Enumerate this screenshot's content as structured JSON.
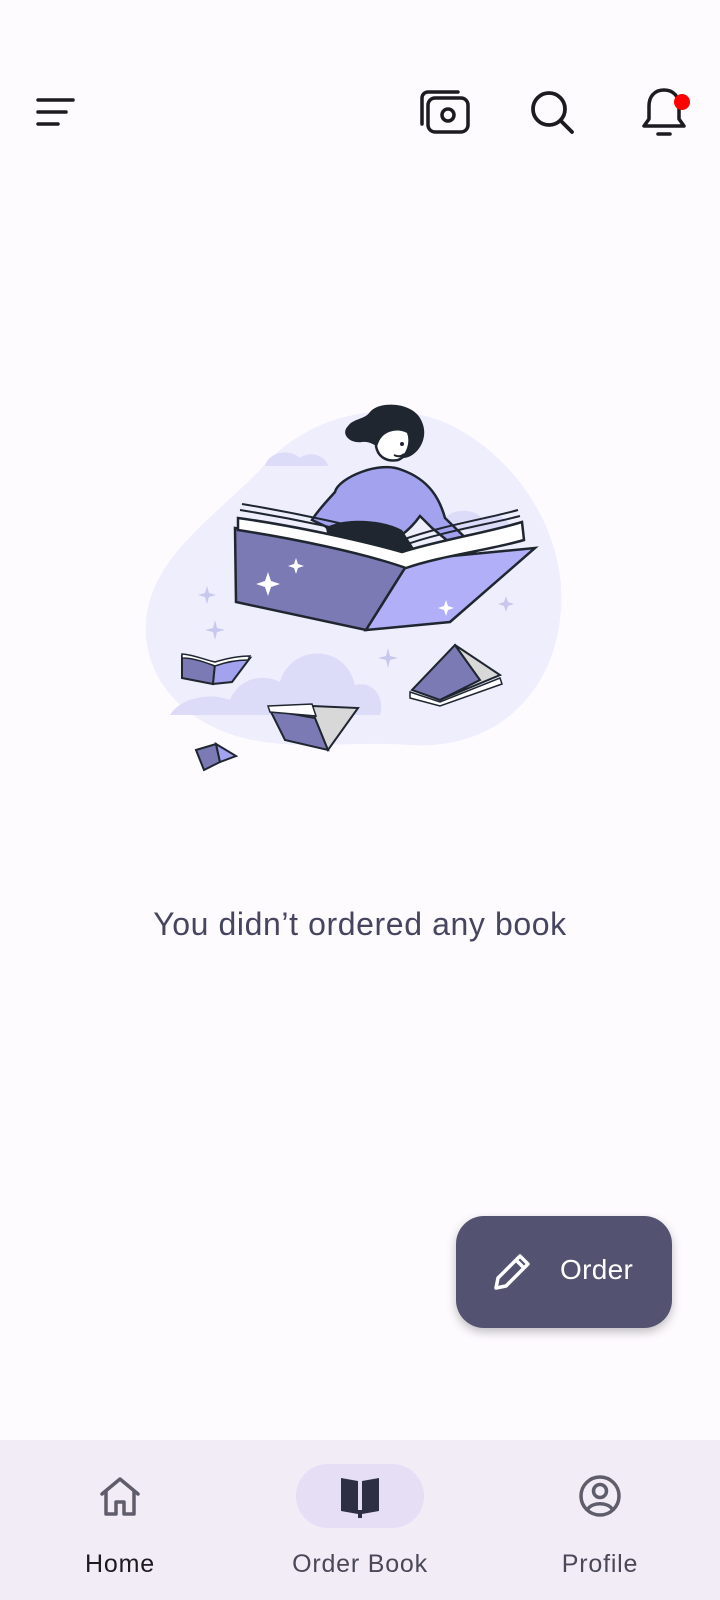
{
  "top_bar": {
    "icons": {
      "menu": "menu-icon",
      "camera": "camera-icon",
      "search": "search-icon",
      "notifications": "bell-icon"
    },
    "notification_dot_color": "#ff0000"
  },
  "illustration": {
    "icon": "woman-reading-flying-book-illustration"
  },
  "empty_state": {
    "message": "You didn’t ordered any book"
  },
  "fab": {
    "label": "Order",
    "icon": "pencil-icon",
    "color": "#535271"
  },
  "bottom_nav": {
    "items": [
      {
        "label": "Home",
        "icon": "home-icon"
      },
      {
        "label": "Order Book",
        "icon": "book-icon",
        "selected": true
      },
      {
        "label": "Profile",
        "icon": "profile-icon"
      }
    ]
  },
  "colors": {
    "background": "#fefbff",
    "text_primary": "#45455f",
    "accent": "#8e8ecf",
    "nav_background": "#f2ecf7",
    "nav_indicator": "#e6def5"
  }
}
